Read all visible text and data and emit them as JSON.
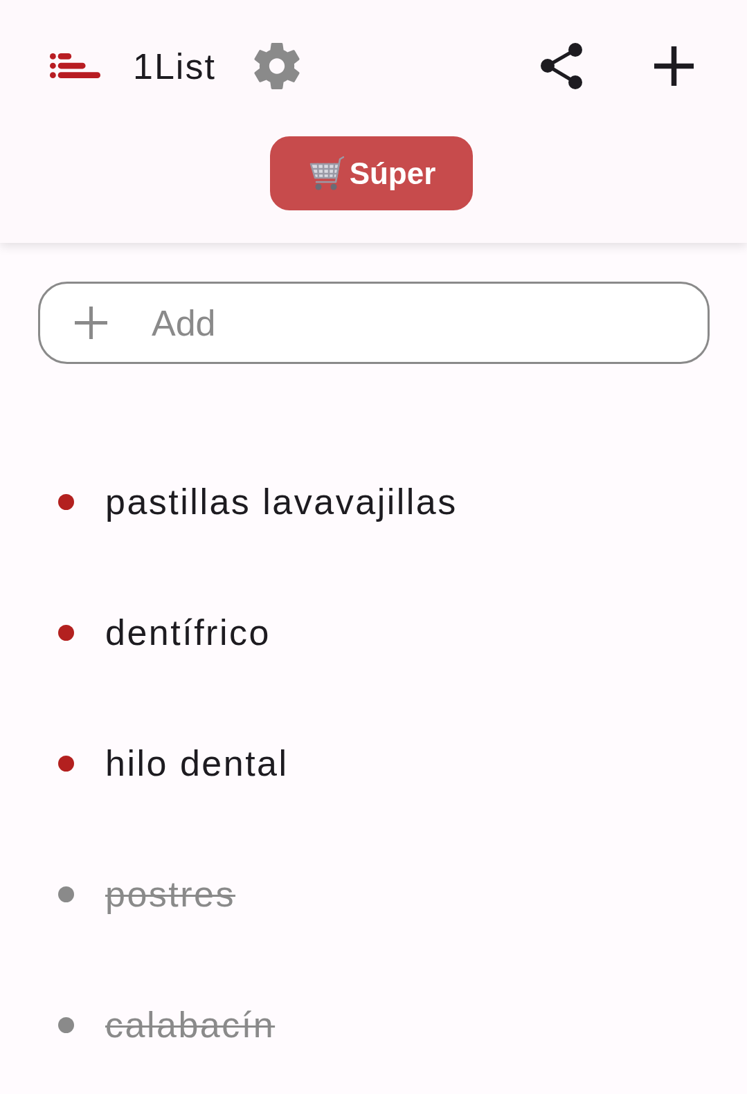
{
  "app_bar": {
    "title": "1List"
  },
  "list_tab": {
    "label": "Súper",
    "selected": true
  },
  "add_field": {
    "placeholder": "Add"
  },
  "items": [
    {
      "text": "pastillas lavavajillas",
      "checked": false
    },
    {
      "text": "dentífrico",
      "checked": false
    },
    {
      "text": "hilo dental",
      "checked": false
    },
    {
      "text": "postres",
      "checked": true
    },
    {
      "text": "calabacín",
      "checked": true
    }
  ]
}
